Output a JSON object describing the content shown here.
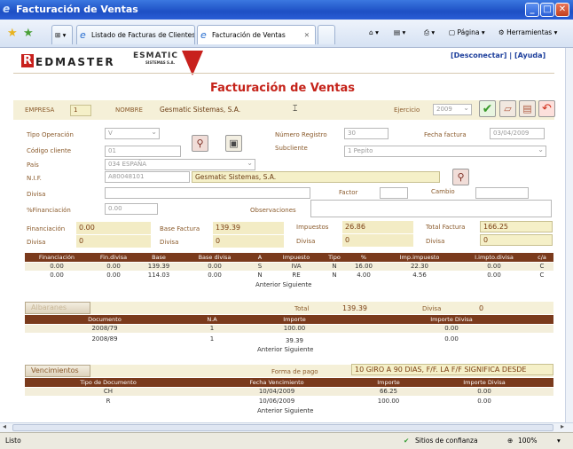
{
  "window": {
    "title": "Facturación de Ventas"
  },
  "browser": {
    "tabs": [
      {
        "label": "Listado de Facturas de Clientes"
      },
      {
        "label": "Facturación de Ventas"
      }
    ],
    "tools": {
      "page": "Página",
      "tools": "Herramientas"
    }
  },
  "header": {
    "brand_r": "R",
    "brand_rest": "EDMASTER",
    "brand2": "ESMATIC",
    "brand2_sub": "SISTEMAS S.A.",
    "disconnect": "[Desconectar]",
    "sep": "|",
    "help": "[Ayuda]"
  },
  "page": {
    "title": "Facturación de Ventas"
  },
  "top": {
    "empresa_label": "EMPRESA",
    "empresa": "1",
    "nombre_label": "NOMBRE",
    "nombre": "Gesmatic Sistemas, S.A.",
    "ejercicio_label": "Ejercicio",
    "ejercicio": "2009"
  },
  "form": {
    "tipo_op_label": "Tipo Operación",
    "tipo_op": "V",
    "num_reg_label": "Número Registro",
    "num_reg": "30",
    "fecha_label": "Fecha factura",
    "fecha": "03/04/2009",
    "cod_cli_label": "Código cliente",
    "cod_cli": "01",
    "subcliente_label": "Subcliente",
    "subcliente": "1 Pepito",
    "pais_label": "País",
    "pais": "034 ESPAÑA",
    "nif_label": "N.I.F.",
    "nif": "A80048101",
    "nif_name": "Gesmatic Sistemas, S.A.",
    "divisa_label": "Divisa",
    "divisa": "",
    "factor_label": "Factor",
    "cambio_label": "Cambio",
    "financ_label": "%Financiación",
    "financ": "0.00",
    "obs_label": "Observaciones"
  },
  "totals": {
    "fin_label": "Financiación",
    "fin": "0.00",
    "base_label": "Base Factura",
    "base": "139.39",
    "imp_label": "Impuestos",
    "imp": "26.86",
    "total_label": "Total Factura",
    "total": "166.25",
    "div1_label": "Divisa",
    "div1": "0",
    "div2_label": "Divisa",
    "div2": "0",
    "div3_label": "Divisa",
    "div3": "0",
    "div4_label": "Divisa",
    "div4": "0"
  },
  "tax_table": {
    "headers": [
      "Financiación",
      "Fin.divisa",
      "Base",
      "Base divisa",
      "A",
      "Impuesto",
      "Tipo",
      "%",
      "Imp.impuesto",
      "I.impto.divisa",
      "c/a"
    ],
    "rows": [
      [
        "0.00",
        "0.00",
        "139.39",
        "0.00",
        "S",
        "IVA",
        "N",
        "16.00",
        "22.30",
        "0.00",
        "C"
      ],
      [
        "0.00",
        "0.00",
        "114.03",
        "0.00",
        "N",
        "RE",
        "N",
        "4.00",
        "4.56",
        "0.00",
        "C"
      ]
    ],
    "pager": "Anterior Siguiente"
  },
  "albaranes": {
    "button": "Albaranes",
    "total_label": "Total",
    "total": "139.39",
    "divisa_label": "Divisa",
    "divisa": "0",
    "headers": [
      "Documento",
      "N.A",
      "Importe",
      "Importe Divisa"
    ],
    "rows": [
      [
        "2008/79",
        "1",
        "100.00",
        "0.00"
      ],
      [
        "2008/89",
        "1",
        "39.39",
        "0.00"
      ]
    ],
    "pager": "Anterior Siguiente"
  },
  "vencimientos": {
    "button": "Vencimientos",
    "forma_label": "Forma de pago",
    "forma": "10 GIRO A 90 DIAS, F/F. LA F/F SIGNIFICA DESDE",
    "headers": [
      "Tipo de Documento",
      "Fecha Vencimiento",
      "Importe",
      "Importe Divisa"
    ],
    "rows": [
      [
        "CH",
        "10/04/2009",
        "66.25",
        "0.00"
      ],
      [
        "R",
        "10/06/2009",
        "100.00",
        "0.00"
      ]
    ],
    "pager": "Anterior Siguiente"
  },
  "statusbar": {
    "left": "Listo",
    "zone": "Sitios de confianza",
    "zoom": "100%"
  }
}
